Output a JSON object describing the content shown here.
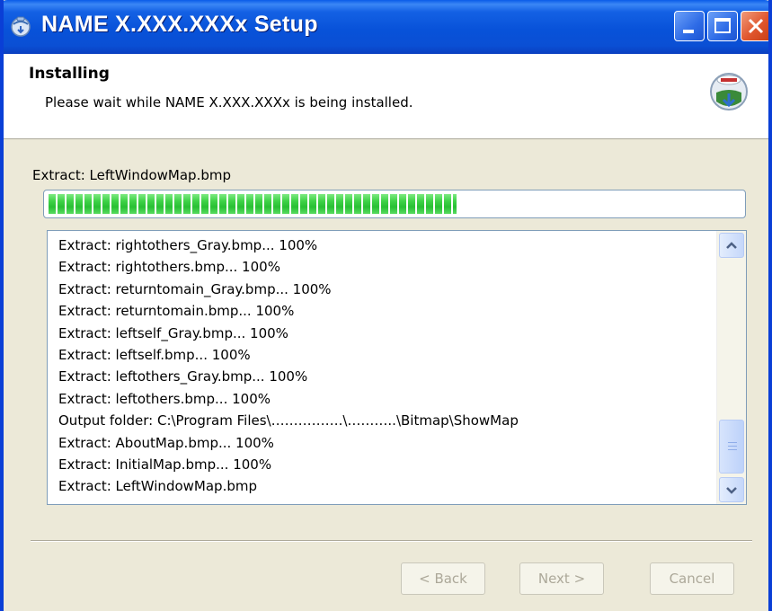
{
  "window": {
    "title": "NAME  X.XXX.XXXx Setup"
  },
  "header": {
    "title": "Installing",
    "subtitle": "Please wait while NAME X.XXX.XXXx is being installed."
  },
  "status": {
    "current": "Extract: LeftWindowMap.bmp",
    "progress_fraction": 0.59
  },
  "log": [
    "Extract: rightothers_Gray.bmp... 100%",
    "Extract: rightothers.bmp... 100%",
    "Extract: returntomain_Gray.bmp... 100%",
    "Extract: returntomain.bmp... 100%",
    "Extract: leftself_Gray.bmp... 100%",
    "Extract: leftself.bmp... 100%",
    "Extract: leftothers_Gray.bmp... 100%",
    "Extract: leftothers.bmp... 100%",
    "Output folder: C:\\Program Files\\…………….\\………..\\Bitmap\\ShowMap",
    "Extract: AboutMap.bmp... 100%",
    "Extract: InitialMap.bmp... 100%",
    "Extract: LeftWindowMap.bmp"
  ],
  "buttons": {
    "back_label": "< Back",
    "next_label": "Next >",
    "cancel_label": "Cancel"
  },
  "icons": {
    "app": "installer-globe-icon",
    "header": "nsis-installer-logo-icon"
  },
  "colors": {
    "titlebar": "#0A4FD4",
    "progress": "#28C033",
    "face": "#ECE9D8"
  }
}
